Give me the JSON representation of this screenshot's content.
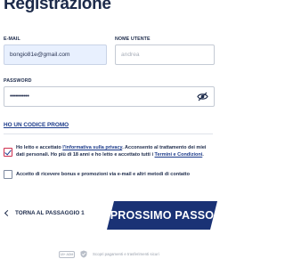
{
  "header": {
    "title": "Registrazione"
  },
  "form": {
    "email": {
      "label": "E-MAIL",
      "value": "bongio81e@gmail.com"
    },
    "username": {
      "label": "NOME UTENTE",
      "placeholder": "andrea"
    },
    "password": {
      "label": "PASSWORD",
      "value": "•••••••••••"
    },
    "promo_link": "HO UN CODICE PROMO"
  },
  "consents": {
    "privacy": {
      "checked": true,
      "text_prefix": "Ho letto e accettato ",
      "privacy_link": "l'informativa sulla privacy",
      "text_middle": ". Acconsento al trattamento dei miei dati personali. Ho più di 18 anni e ho letto e accettato tutti i ",
      "terms_link": "Termini e Condizioni",
      "text_suffix": "."
    },
    "marketing": {
      "checked": false,
      "text": "Accetto di ricevere bonus e promozioni via e-mail e altri metodi di contatto"
    }
  },
  "navigation": {
    "back_label": "TORNA AL PASSAGGIO 1",
    "next_label": "PROSSIMO PASSO"
  },
  "footer": {
    "age_badge": "18+ ADM",
    "security_text": "Scopri pagamenti e trasferimenti sicuri"
  },
  "colors": {
    "primary": "#1a3275",
    "text": "#1d2b4b",
    "checkbox_border_checked": "#cf2e4e",
    "email_fill": "#e8f0fe"
  }
}
